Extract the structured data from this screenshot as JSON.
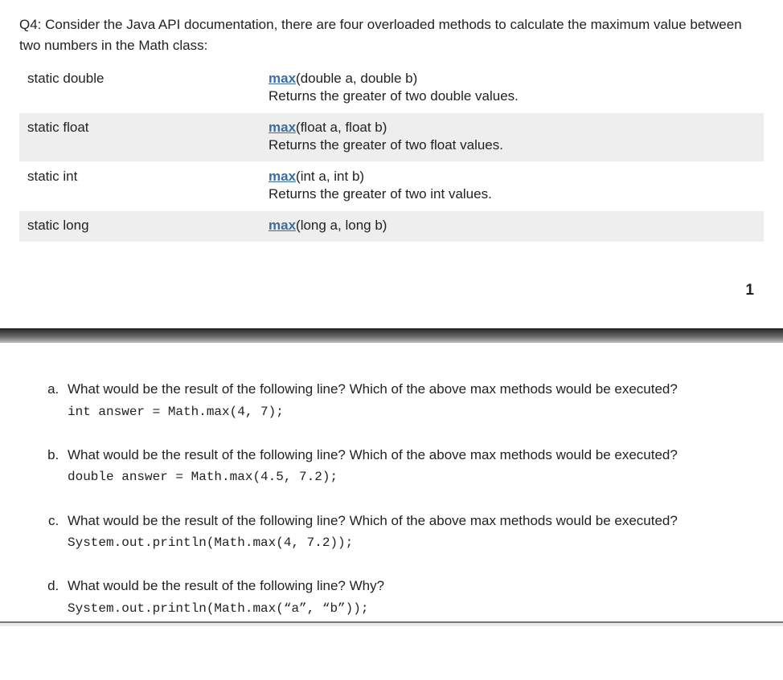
{
  "question": "Q4: Consider the Java API documentation, there are four overloaded methods to calculate the maximum value between two numbers in the Math class:",
  "api_rows": [
    {
      "modifier": "static double",
      "method": "max",
      "params": "(double a, double b)",
      "desc": "Returns the greater of two double values.",
      "alt": false
    },
    {
      "modifier": "static float",
      "method": "max",
      "params": "(float a, float b)",
      "desc": "Returns the greater of two float values.",
      "alt": true
    },
    {
      "modifier": "static int",
      "method": "max",
      "params": "(int a, int b)",
      "desc": "Returns the greater of two int values.",
      "alt": false
    },
    {
      "modifier": "static long",
      "method": "max",
      "params": "(long a, long b)",
      "desc": "",
      "alt": true
    }
  ],
  "page_number": "1",
  "subquestions": [
    {
      "prompt": "What would be the result of the following line? Which of the above max methods would be executed?",
      "code": "int answer = Math.max(4, 7);"
    },
    {
      "prompt": "What would be the result of the following line? Which of the above max methods would be executed?",
      "code": "double answer = Math.max(4.5, 7.2);"
    },
    {
      "prompt": "What would be the result of the following line? Which of the above max methods would be executed?",
      "code": "System.out.println(Math.max(4, 7.2));"
    },
    {
      "prompt": "What would be the result of the following line? Why?",
      "code": "System.out.println(Math.max(“a”, “b”));"
    }
  ]
}
